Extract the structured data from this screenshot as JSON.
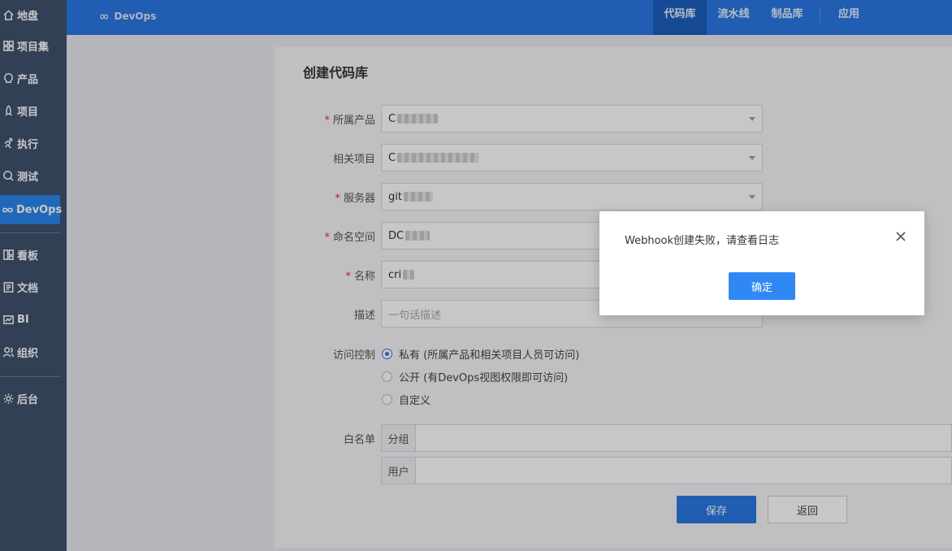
{
  "sidebar": {
    "items": [
      {
        "label": "地盘",
        "icon": "home-icon"
      },
      {
        "label": "项目集",
        "icon": "grid-icon"
      },
      {
        "label": "产品",
        "icon": "bulb-icon"
      },
      {
        "label": "项目",
        "icon": "rocket-icon"
      },
      {
        "label": "执行",
        "icon": "run-icon"
      },
      {
        "label": "测试",
        "icon": "search-icon"
      },
      {
        "label": "DevOps",
        "icon": "infinity-icon",
        "active": true
      },
      {
        "label": "看板",
        "icon": "board-icon"
      },
      {
        "label": "文档",
        "icon": "doc-icon"
      },
      {
        "label": "BI",
        "icon": "chart-icon"
      },
      {
        "label": "组织",
        "icon": "users-icon"
      },
      {
        "label": "后台",
        "icon": "gear-icon"
      }
    ]
  },
  "header": {
    "brand": "DevOps",
    "tabs": [
      {
        "label": "代码库",
        "active": true
      },
      {
        "label": "流水线"
      },
      {
        "label": "制品库"
      },
      {
        "label": "应用"
      }
    ],
    "accent_color": "#2b78e4"
  },
  "form": {
    "title": "创建代码库",
    "fields": {
      "product": {
        "label": "所属产品",
        "value": "C"
      },
      "project": {
        "label": "相关项目",
        "value": "C"
      },
      "server": {
        "label": "服务器",
        "value": "git"
      },
      "namespace": {
        "label": "命名空间",
        "value": "DC"
      },
      "name": {
        "label": "名称",
        "value": "cri"
      },
      "description": {
        "label": "描述",
        "placeholder": "一句话描述"
      }
    },
    "access": {
      "label": "访问控制",
      "options": [
        {
          "label": "私有 (所属产品和相关项目人员可访问)",
          "selected": true
        },
        {
          "label": "公开 (有DevOps视图权限即可访问)",
          "selected": false
        },
        {
          "label": "自定义",
          "selected": false
        }
      ]
    },
    "whitelist": {
      "label": "白名单",
      "group_label": "分组",
      "user_label": "用户"
    },
    "save_label": "保存",
    "back_label": "返回"
  },
  "dialog": {
    "message": "Webhook创建失败，请查看日志",
    "ok_label": "确定"
  }
}
